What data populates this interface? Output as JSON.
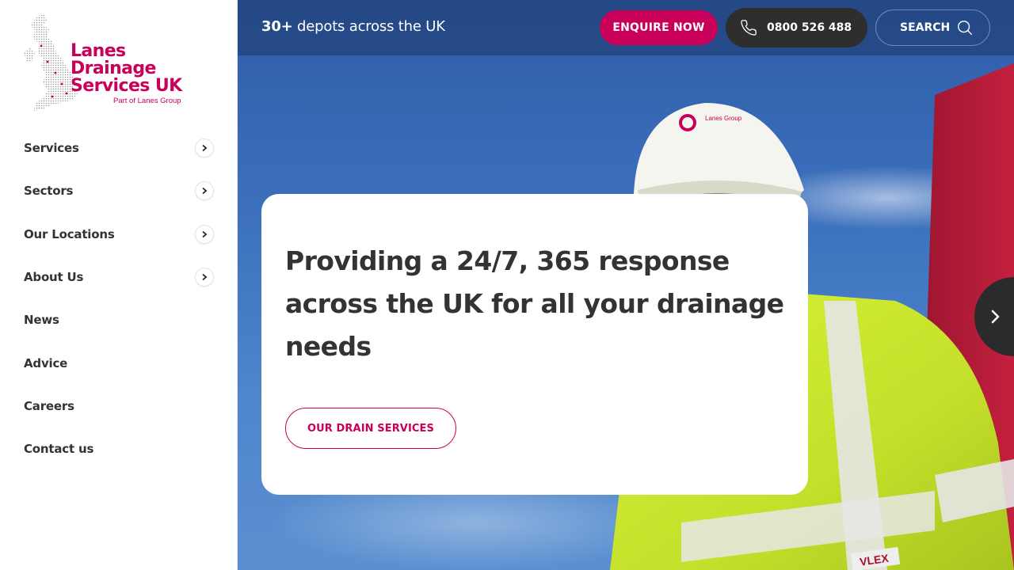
{
  "brand": {
    "name_line1": "Lanes Drainage",
    "name_line2": "Services UK",
    "tagline": "Part of Lanes Group",
    "primary_color": "#c8005a"
  },
  "sidebar": {
    "items": [
      {
        "label": "Services",
        "has_submenu": true
      },
      {
        "label": "Sectors",
        "has_submenu": true
      },
      {
        "label": "Our Locations",
        "has_submenu": true
      },
      {
        "label": "About Us",
        "has_submenu": true
      },
      {
        "label": "News",
        "has_submenu": false
      },
      {
        "label": "Advice",
        "has_submenu": false
      },
      {
        "label": "Careers",
        "has_submenu": false
      },
      {
        "label": "Contact us",
        "has_submenu": false
      }
    ]
  },
  "topbar": {
    "depots_count": "30+",
    "depots_text": " depots across the UK",
    "enquire_label": "ENQUIRE NOW",
    "phone_number": "0800 526 488",
    "search_label": "SEARCH"
  },
  "hero": {
    "title": "Providing a 24/7, 365 response across the UK for all your drainage needs",
    "cta_label": "OUR DRAIN SERVICES",
    "helmet_brand": "Lanes Group",
    "vest_brand": "VLEX"
  }
}
